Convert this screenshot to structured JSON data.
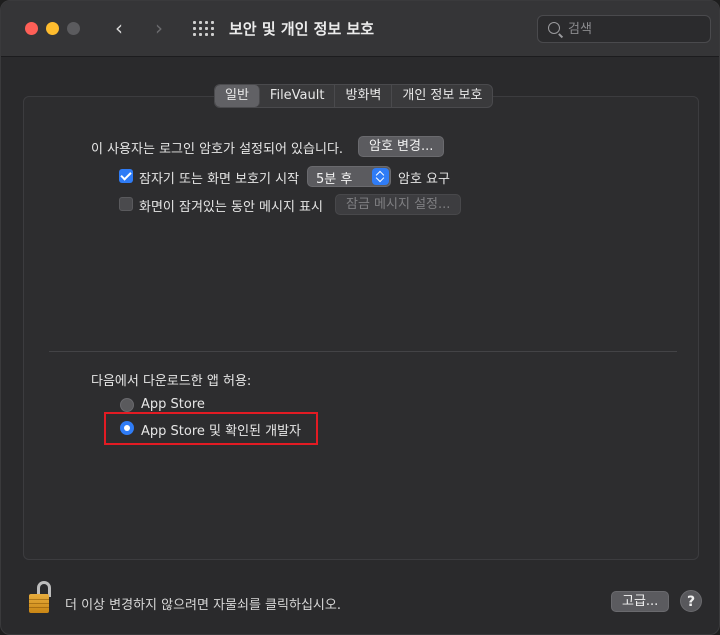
{
  "window": {
    "title": "보안 및 개인 정보 보호"
  },
  "search": {
    "placeholder": "검색"
  },
  "tabs": [
    {
      "label": "일반",
      "active": true
    },
    {
      "label": "FileVault",
      "active": false
    },
    {
      "label": "방화벽",
      "active": false
    },
    {
      "label": "개인 정보 보호",
      "active": false
    }
  ],
  "general": {
    "password_text": "이 사용자는 로그인 암호가 설정되어 있습니다.",
    "change_password_button": "암호 변경...",
    "require_password": {
      "checked": true,
      "label_before": "잠자기 또는 화면 보호기 시작",
      "delay_value": "5분 후",
      "label_after": "암호 요구"
    },
    "lock_message": {
      "checked": false,
      "label": "화면이 잠겨있는 동안 메시지 표시",
      "button": "잠금 메시지 설정..."
    },
    "allow_downloads_label": "다음에서 다운로드한 앱 허용:",
    "options": [
      {
        "label": "App Store",
        "selected": false
      },
      {
        "label": "App Store 및 확인된 개발자",
        "selected": true
      }
    ]
  },
  "footer": {
    "lock_text": "더 이상 변경하지 않으려면 자물쇠를 클릭하십시오.",
    "advanced_button": "고급...",
    "help_label": "?"
  },
  "colors": {
    "accent": "#2f7cf6",
    "highlight_box": "#e31b23",
    "lock_gold": "#d9982a"
  }
}
